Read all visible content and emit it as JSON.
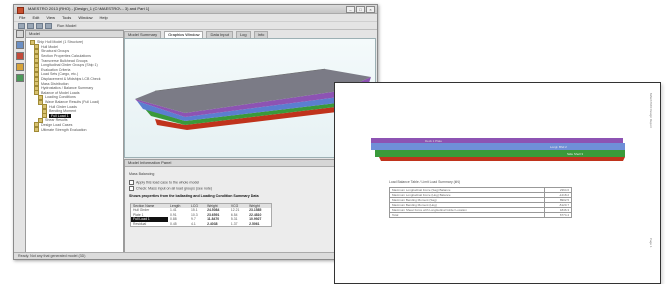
{
  "app": {
    "title": "MAESTRO 2013 (RHO) - [Design_1 (C:\\MAESTRO\\... 3) and Part 1]",
    "menus": [
      "File",
      "Edit",
      "View",
      "Tools",
      "Window",
      "Help"
    ],
    "toolbar_label": "Run Model",
    "tree_title": "Model",
    "tree_items": [
      {
        "label": "Ship Hull Model (1 Structure)",
        "depth": 0
      },
      {
        "label": "Hull Model",
        "depth": 1
      },
      {
        "label": "Structural Groups",
        "depth": 1
      },
      {
        "label": "Section Properties Calculations",
        "depth": 1
      },
      {
        "label": "Transverse Bulkhead Groups",
        "depth": 1
      },
      {
        "label": "Longitudinal Girder Groups (Ship 1)",
        "depth": 1
      },
      {
        "label": "Evaluation Criteria",
        "depth": 1
      },
      {
        "label": "Load Sets (Cargo, etc.)",
        "depth": 1
      },
      {
        "label": "Displacement & Midships LCB Check",
        "depth": 1
      },
      {
        "label": "Mass Distribution",
        "depth": 1
      },
      {
        "label": "Hydrostatics / Balance Summary",
        "depth": 1
      },
      {
        "label": "Balance of Model Loads",
        "depth": 1
      },
      {
        "label": "Loading Conditions",
        "depth": 2
      },
      {
        "label": "Wave Balance Results (Full Load)",
        "depth": 2
      },
      {
        "label": "Hull Girder Loads",
        "depth": 3
      },
      {
        "label": "Bending Moment",
        "depth": 3
      },
      {
        "label": "Full Load 1",
        "depth": 3,
        "selected": true
      },
      {
        "label": "Shear Results",
        "depth": 2
      },
      {
        "label": "Design Load Cases",
        "depth": 1
      },
      {
        "label": "Ultimate Strength Evaluation",
        "depth": 1
      }
    ],
    "view_tabs": [
      "Model Summary",
      "Graphics Window",
      "Data Input",
      "Log",
      "Info"
    ],
    "active_tab": "Graphics Window",
    "info_tab": "Model Information Panel",
    "info": {
      "section": "Mass Balancing",
      "line1": "Apply this load case to the whole model",
      "line2": "Check: Mass input on all load groups (see note)",
      "button": "Balance...",
      "heading": "Shows properties from the ballasting and Loading Condition Summary Data"
    },
    "table": {
      "headers": [
        "Section Name",
        "Length",
        "LCG",
        "Weight",
        "VCG",
        "Weight"
      ],
      "rows": [
        {
          "name": "Hull Girder",
          "c1": "1.41",
          "c2": "15.1",
          "c3": "24.5084",
          "c4": "12.21",
          "c5": "23.1585"
        },
        {
          "name": "Plate 1",
          "c1": "0.91",
          "c2": "10.3",
          "c3": "23.6591",
          "c4": "6.54",
          "c5": "22.4810"
        },
        {
          "name": "Full Load 1",
          "c1": "0.88",
          "c2": "9.7",
          "c3": "11.8470",
          "c4": "5.31",
          "c5": "10.9927",
          "hl": true
        },
        {
          "name": "Residual",
          "c1": "0.45",
          "c2": "4.1",
          "c3": "2.4038",
          "c4": "1.37",
          "c5": "2.5061"
        }
      ]
    },
    "status": "Ready. Not any that generated model (3D)"
  },
  "report": {
    "hull_labels": [
      "Deck 1 Plate",
      "Longl. Bhd 2",
      "Side Shell 3"
    ],
    "table_caption": "Load Balance Table / Limit Load Summary (kN)",
    "table_rows": [
      {
        "label": "Maximum Longitudinal Force (Sag) Balance",
        "value": "2364.6"
      },
      {
        "label": "Maximum Longitudinal Force (Hog) Balance",
        "value": "-1218.2"
      },
      {
        "label": "Maximum Bending Moment (Sag)",
        "value": "8902.5"
      },
      {
        "label": "Maximum Bending Moment (Hog)",
        "value": "-5120.7"
      },
      {
        "label": "Maximum Shear Force with Longitudinal Girder Location",
        "value": "1846.3"
      },
      {
        "label": "Total",
        "value": "6774.4"
      }
    ],
    "side_text_top": "MAESTRO Design Report",
    "side_text_bottom": "Page 1"
  },
  "colors": {
    "deck": "#7d7d8a",
    "purple": "#7a3f9e",
    "blue": "#5b7ed0",
    "green": "#3a9a3a",
    "red": "#c0331c"
  }
}
